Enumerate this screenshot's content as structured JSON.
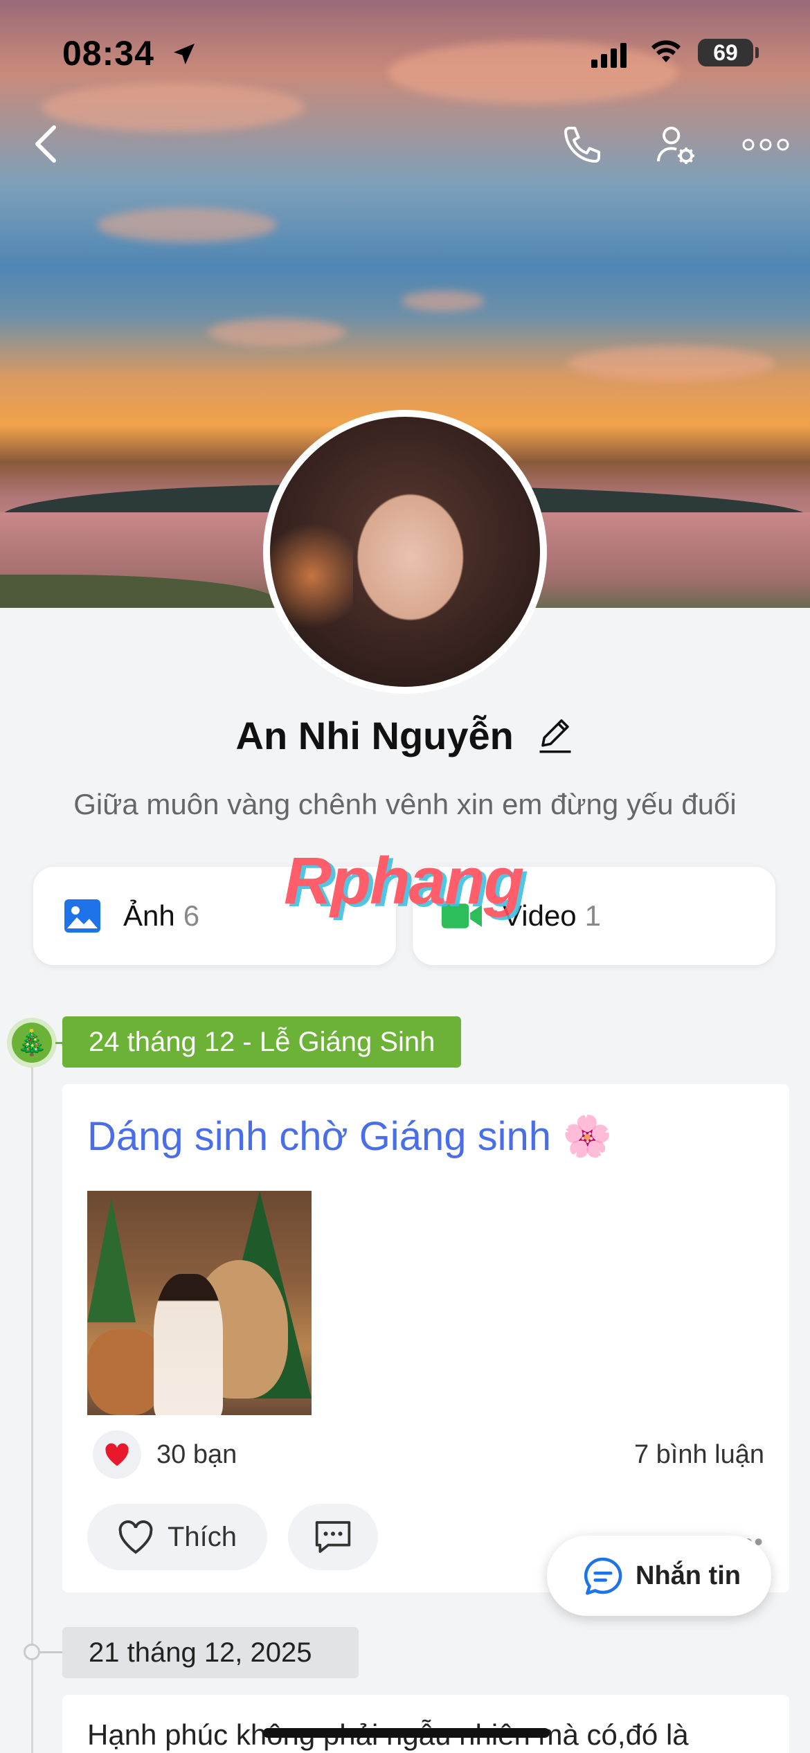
{
  "status_bar": {
    "time": "08:34",
    "location_icon": "location-arrow-icon",
    "battery": "69"
  },
  "nav": {
    "back_icon": "chevron-left-icon",
    "call_icon": "phone-icon",
    "settings_icon": "user-gear-icon",
    "more_icon": "ellipsis-icon"
  },
  "profile": {
    "name": "An Nhi Nguyễn",
    "bio": "Giữa muôn vàng chênh vênh xin em đừng yếu đuối"
  },
  "watermark": "Rphang",
  "media": {
    "photos": {
      "label": "Ảnh",
      "count": "6"
    },
    "videos": {
      "label": "Video",
      "count": "1"
    }
  },
  "timeline": {
    "event": "24 tháng 12 - Lễ Giáng Sinh",
    "post": {
      "title": "Dáng sinh chờ Giáng sinh 🌸",
      "reactions": "30 bạn",
      "comments": "7 bình luận",
      "like_label": "Thích",
      "more": "•••"
    },
    "next_date": "21 tháng 12, 2025",
    "next_post_text": "Hạnh phúc không phải ngẫu nhiên mà có,đó là"
  },
  "chat_button": {
    "label": "Nhắn tin"
  },
  "colors": {
    "accent_blue": "#4a6de8",
    "event_green": "#6bb236",
    "video_green": "#2dbd5a",
    "photo_blue": "#1e73e8",
    "heart_red": "#e8192c"
  }
}
